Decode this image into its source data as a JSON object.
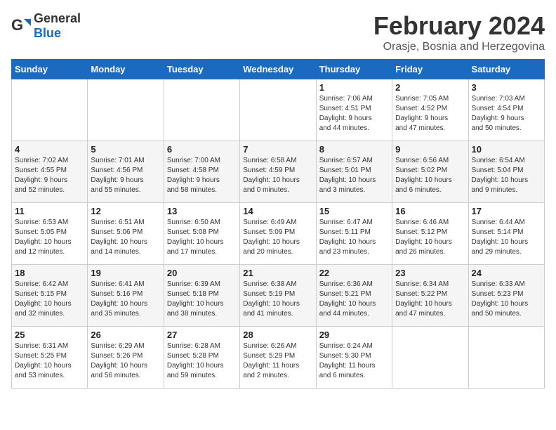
{
  "header": {
    "logo_general": "General",
    "logo_blue": "Blue",
    "month_title": "February 2024",
    "location": "Orasje, Bosnia and Herzegovina"
  },
  "calendar": {
    "days_of_week": [
      "Sunday",
      "Monday",
      "Tuesday",
      "Wednesday",
      "Thursday",
      "Friday",
      "Saturday"
    ],
    "weeks": [
      [
        {
          "day": "",
          "info": ""
        },
        {
          "day": "",
          "info": ""
        },
        {
          "day": "",
          "info": ""
        },
        {
          "day": "",
          "info": ""
        },
        {
          "day": "1",
          "info": "Sunrise: 7:06 AM\nSunset: 4:51 PM\nDaylight: 9 hours\nand 44 minutes."
        },
        {
          "day": "2",
          "info": "Sunrise: 7:05 AM\nSunset: 4:52 PM\nDaylight: 9 hours\nand 47 minutes."
        },
        {
          "day": "3",
          "info": "Sunrise: 7:03 AM\nSunset: 4:54 PM\nDaylight: 9 hours\nand 50 minutes."
        }
      ],
      [
        {
          "day": "4",
          "info": "Sunrise: 7:02 AM\nSunset: 4:55 PM\nDaylight: 9 hours\nand 52 minutes."
        },
        {
          "day": "5",
          "info": "Sunrise: 7:01 AM\nSunset: 4:56 PM\nDaylight: 9 hours\nand 55 minutes."
        },
        {
          "day": "6",
          "info": "Sunrise: 7:00 AM\nSunset: 4:58 PM\nDaylight: 9 hours\nand 58 minutes."
        },
        {
          "day": "7",
          "info": "Sunrise: 6:58 AM\nSunset: 4:59 PM\nDaylight: 10 hours\nand 0 minutes."
        },
        {
          "day": "8",
          "info": "Sunrise: 6:57 AM\nSunset: 5:01 PM\nDaylight: 10 hours\nand 3 minutes."
        },
        {
          "day": "9",
          "info": "Sunrise: 6:56 AM\nSunset: 5:02 PM\nDaylight: 10 hours\nand 6 minutes."
        },
        {
          "day": "10",
          "info": "Sunrise: 6:54 AM\nSunset: 5:04 PM\nDaylight: 10 hours\nand 9 minutes."
        }
      ],
      [
        {
          "day": "11",
          "info": "Sunrise: 6:53 AM\nSunset: 5:05 PM\nDaylight: 10 hours\nand 12 minutes."
        },
        {
          "day": "12",
          "info": "Sunrise: 6:51 AM\nSunset: 5:06 PM\nDaylight: 10 hours\nand 14 minutes."
        },
        {
          "day": "13",
          "info": "Sunrise: 6:50 AM\nSunset: 5:08 PM\nDaylight: 10 hours\nand 17 minutes."
        },
        {
          "day": "14",
          "info": "Sunrise: 6:49 AM\nSunset: 5:09 PM\nDaylight: 10 hours\nand 20 minutes."
        },
        {
          "day": "15",
          "info": "Sunrise: 6:47 AM\nSunset: 5:11 PM\nDaylight: 10 hours\nand 23 minutes."
        },
        {
          "day": "16",
          "info": "Sunrise: 6:46 AM\nSunset: 5:12 PM\nDaylight: 10 hours\nand 26 minutes."
        },
        {
          "day": "17",
          "info": "Sunrise: 6:44 AM\nSunset: 5:14 PM\nDaylight: 10 hours\nand 29 minutes."
        }
      ],
      [
        {
          "day": "18",
          "info": "Sunrise: 6:42 AM\nSunset: 5:15 PM\nDaylight: 10 hours\nand 32 minutes."
        },
        {
          "day": "19",
          "info": "Sunrise: 6:41 AM\nSunset: 5:16 PM\nDaylight: 10 hours\nand 35 minutes."
        },
        {
          "day": "20",
          "info": "Sunrise: 6:39 AM\nSunset: 5:18 PM\nDaylight: 10 hours\nand 38 minutes."
        },
        {
          "day": "21",
          "info": "Sunrise: 6:38 AM\nSunset: 5:19 PM\nDaylight: 10 hours\nand 41 minutes."
        },
        {
          "day": "22",
          "info": "Sunrise: 6:36 AM\nSunset: 5:21 PM\nDaylight: 10 hours\nand 44 minutes."
        },
        {
          "day": "23",
          "info": "Sunrise: 6:34 AM\nSunset: 5:22 PM\nDaylight: 10 hours\nand 47 minutes."
        },
        {
          "day": "24",
          "info": "Sunrise: 6:33 AM\nSunset: 5:23 PM\nDaylight: 10 hours\nand 50 minutes."
        }
      ],
      [
        {
          "day": "25",
          "info": "Sunrise: 6:31 AM\nSunset: 5:25 PM\nDaylight: 10 hours\nand 53 minutes."
        },
        {
          "day": "26",
          "info": "Sunrise: 6:29 AM\nSunset: 5:26 PM\nDaylight: 10 hours\nand 56 minutes."
        },
        {
          "day": "27",
          "info": "Sunrise: 6:28 AM\nSunset: 5:28 PM\nDaylight: 10 hours\nand 59 minutes."
        },
        {
          "day": "28",
          "info": "Sunrise: 6:26 AM\nSunset: 5:29 PM\nDaylight: 11 hours\nand 2 minutes."
        },
        {
          "day": "29",
          "info": "Sunrise: 6:24 AM\nSunset: 5:30 PM\nDaylight: 11 hours\nand 6 minutes."
        },
        {
          "day": "",
          "info": ""
        },
        {
          "day": "",
          "info": ""
        }
      ]
    ]
  }
}
